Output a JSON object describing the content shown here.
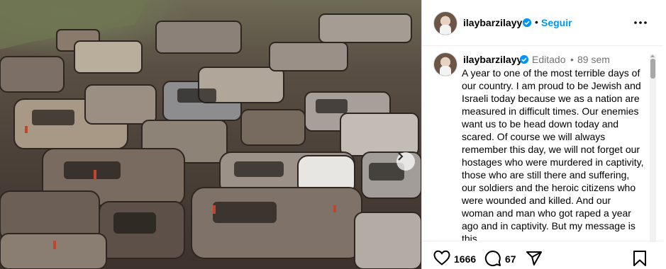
{
  "photo": {
    "alt": "",
    "next_icon": "chevron-right-icon"
  },
  "header": {
    "username": "ilaybarzilayy",
    "separator": "•",
    "follow_label": "Seguir",
    "more_icon": "more-horizontal-icon"
  },
  "caption": {
    "username": "ilaybarzilayy",
    "edited_label": "Editado",
    "separator": "•",
    "time": "89 sem",
    "text": "A year to one of the most terrible days of our country. I am proud to be Jewish and Israeli today because we as a nation are measured in difficult times. Our enemies want us to be head down today and scared. Of course we will always remember this day, we will not forget our hostages who were murdered in captivity, those who are still there and suffering, our soldiers and the heroic citizens who were wounded and killed. And our woman and man who got raped a year ago and in captivity. But my message is this."
  },
  "actions": {
    "like_count": "1666",
    "comment_count": "67",
    "like_icon": "heart-icon",
    "comment_icon": "comment-icon",
    "share_icon": "share-icon",
    "save_icon": "bookmark-icon"
  },
  "colors": {
    "accent": "#0095f6",
    "verified": "#0095f6",
    "muted": "#737373",
    "border": "#dbdbdb"
  }
}
